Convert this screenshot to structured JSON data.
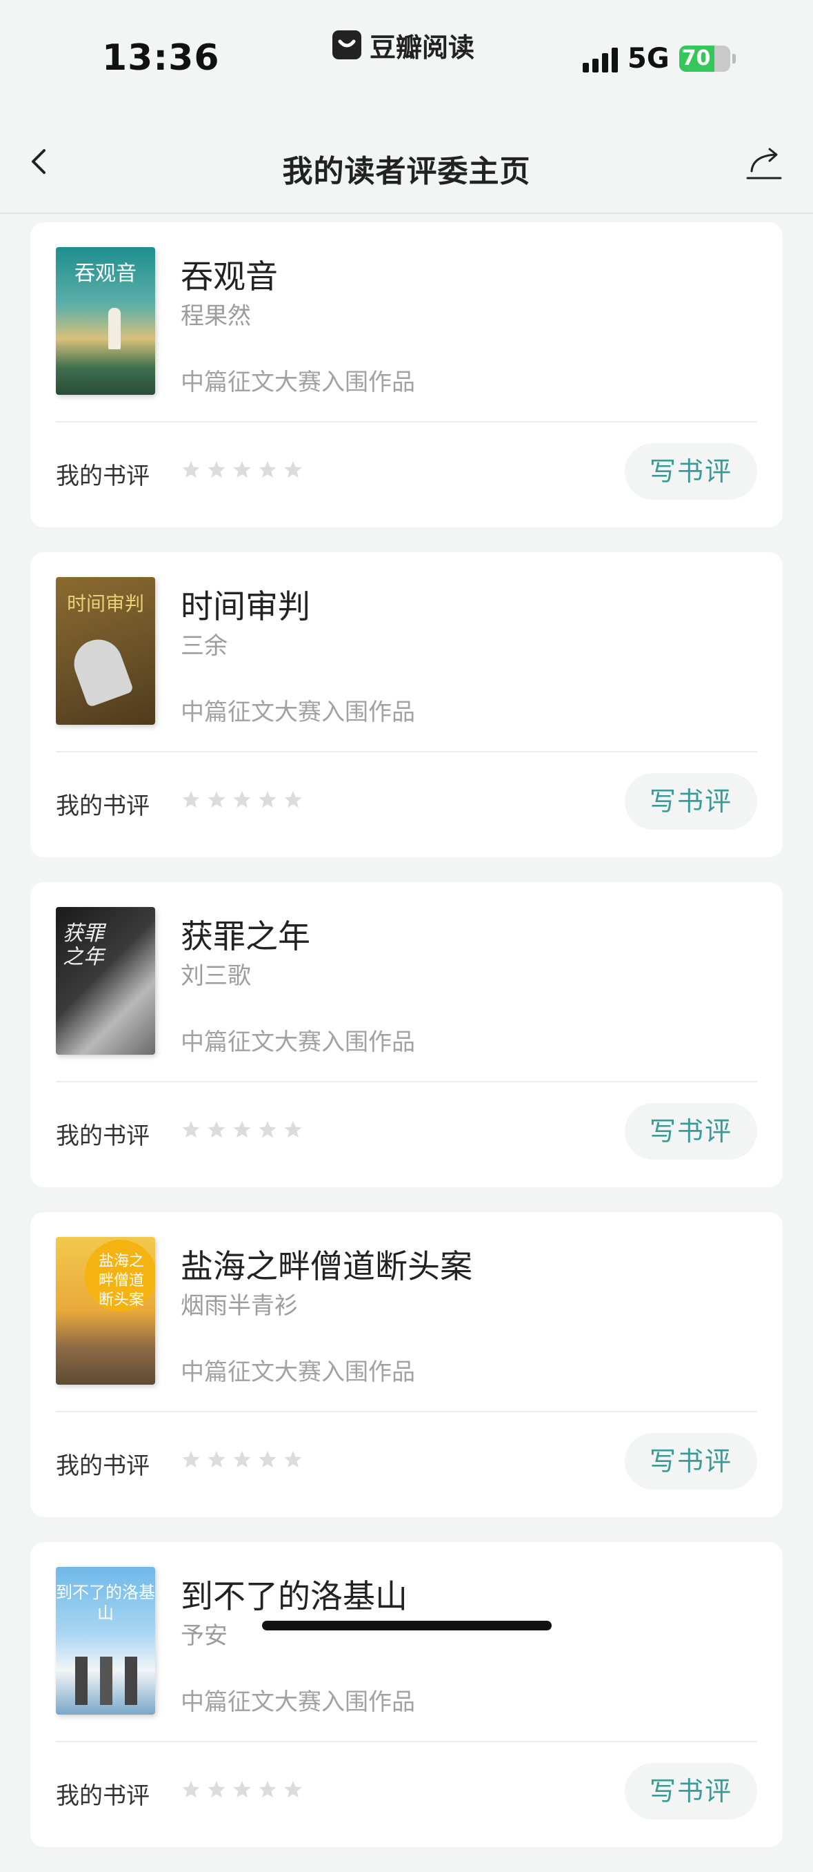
{
  "status_bar": {
    "time": "13:36",
    "app_name": "豆瓣阅读",
    "network": "5G",
    "battery": "70",
    "battery_level": 0.7
  },
  "nav": {
    "title": "我的读者评委主页",
    "back_icon": "chevron-left-icon",
    "share_icon": "share-icon"
  },
  "colors": {
    "accent": "#3a9a98",
    "star_empty": "#dcdcdc",
    "card_bg": "#ffffff",
    "page_bg": "#f3f4f4"
  },
  "books": [
    {
      "title": "吞观音",
      "author": "程果然",
      "tag": "中篇征文大赛入围作品",
      "review_label": "我的书评",
      "write_label": "写书评",
      "cover_text": "吞观音",
      "rating": 0
    },
    {
      "title": "时间审判",
      "author": "三余",
      "tag": "中篇征文大赛入围作品",
      "review_label": "我的书评",
      "write_label": "写书评",
      "cover_text": "时间审判",
      "rating": 0
    },
    {
      "title": "获罪之年",
      "author": "刘三歌",
      "tag": "中篇征文大赛入围作品",
      "review_label": "我的书评",
      "write_label": "写书评",
      "cover_text": "获罪之年",
      "rating": 0
    },
    {
      "title": "盐海之畔僧道断头案",
      "author": "烟雨半青衫",
      "tag": "中篇征文大赛入围作品",
      "review_label": "我的书评",
      "write_label": "写书评",
      "cover_text": "盐海之畔僧道断头案",
      "rating": 0
    },
    {
      "title": "到不了的洛基山",
      "author": "予安",
      "tag": "中篇征文大赛入围作品",
      "review_label": "我的书评",
      "write_label": "写书评",
      "cover_text": "到不了的洛基山",
      "rating": 0
    }
  ]
}
